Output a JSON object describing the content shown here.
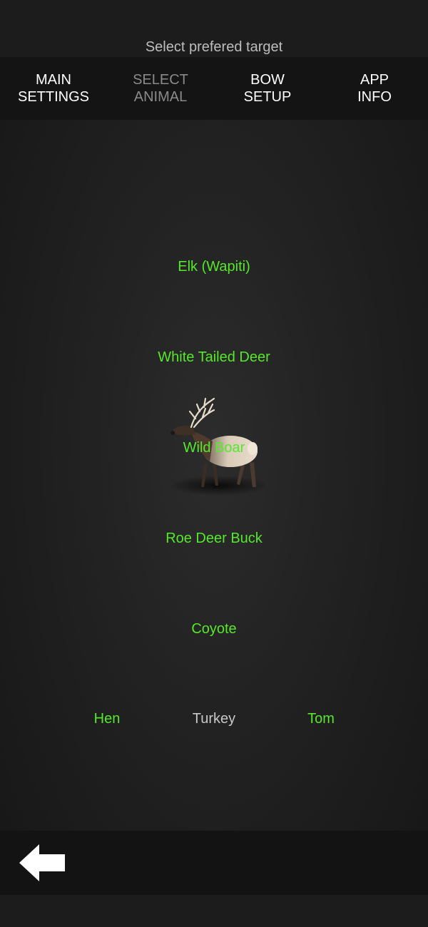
{
  "header": {
    "subtitle": "Select prefered target"
  },
  "tabs": [
    {
      "label": "MAIN\nSETTINGS",
      "active": false
    },
    {
      "label": "SELECT\nANIMAL",
      "active": true
    },
    {
      "label": "BOW\nSETUP",
      "active": false
    },
    {
      "label": "APP\nINFO",
      "active": false
    }
  ],
  "animals": {
    "elk": "Elk (Wapiti)",
    "white_tailed_deer": "White Tailed Deer",
    "wild_boar": "Wild Boar",
    "roe_deer_buck": "Roe Deer Buck",
    "coyote": "Coyote"
  },
  "turkey": {
    "hen": "Hen",
    "label": "Turkey",
    "tom": "Tom"
  },
  "preview": {
    "icon": "elk-model-icon"
  },
  "footer": {
    "back_icon": "back-arrow-icon"
  },
  "colors": {
    "option_green": "#55e82b",
    "tab_active": "#8a8a8a",
    "tab_inactive": "#ffffff"
  }
}
